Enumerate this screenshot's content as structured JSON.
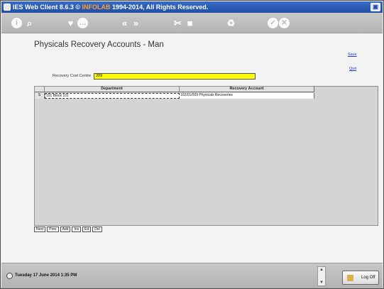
{
  "titlebar": {
    "title_prefix": "IES Web Client 8.6.3 ©",
    "brand": "INFOLAB",
    "title_suffix": "1994-2014, All Rights Reserved."
  },
  "toolbar": {
    "icons": [
      "info-icon",
      "search-icon",
      "heart-icon",
      "chat-icon",
      "back-icon",
      "forward-icon",
      "tools-icon",
      "stop-icon",
      "recycle-icon",
      "check-icon",
      "cancel-icon"
    ]
  },
  "page": {
    "title": "Physicals Recovery Accounts - Man",
    "save_link": "Save",
    "quit_link": "Quit"
  },
  "recovery_cost_centre": {
    "label": "Recovery Cost Centre",
    "value": "209"
  },
  "grid": {
    "columns": [
      "Department",
      "Recovery Account"
    ],
    "rows": [
      {
        "indicator": "S",
        "department": "101 Block 101",
        "recovery_account": "102/01/009 Physicals Recoveries"
      }
    ]
  },
  "nav_buttons": [
    "Next",
    "Prev",
    "Add",
    "Ins",
    "Ed",
    "Del"
  ],
  "status": {
    "datetime": "Tuesday 17 June 2014 1:35 PM",
    "logoff_label": "Log Off"
  }
}
